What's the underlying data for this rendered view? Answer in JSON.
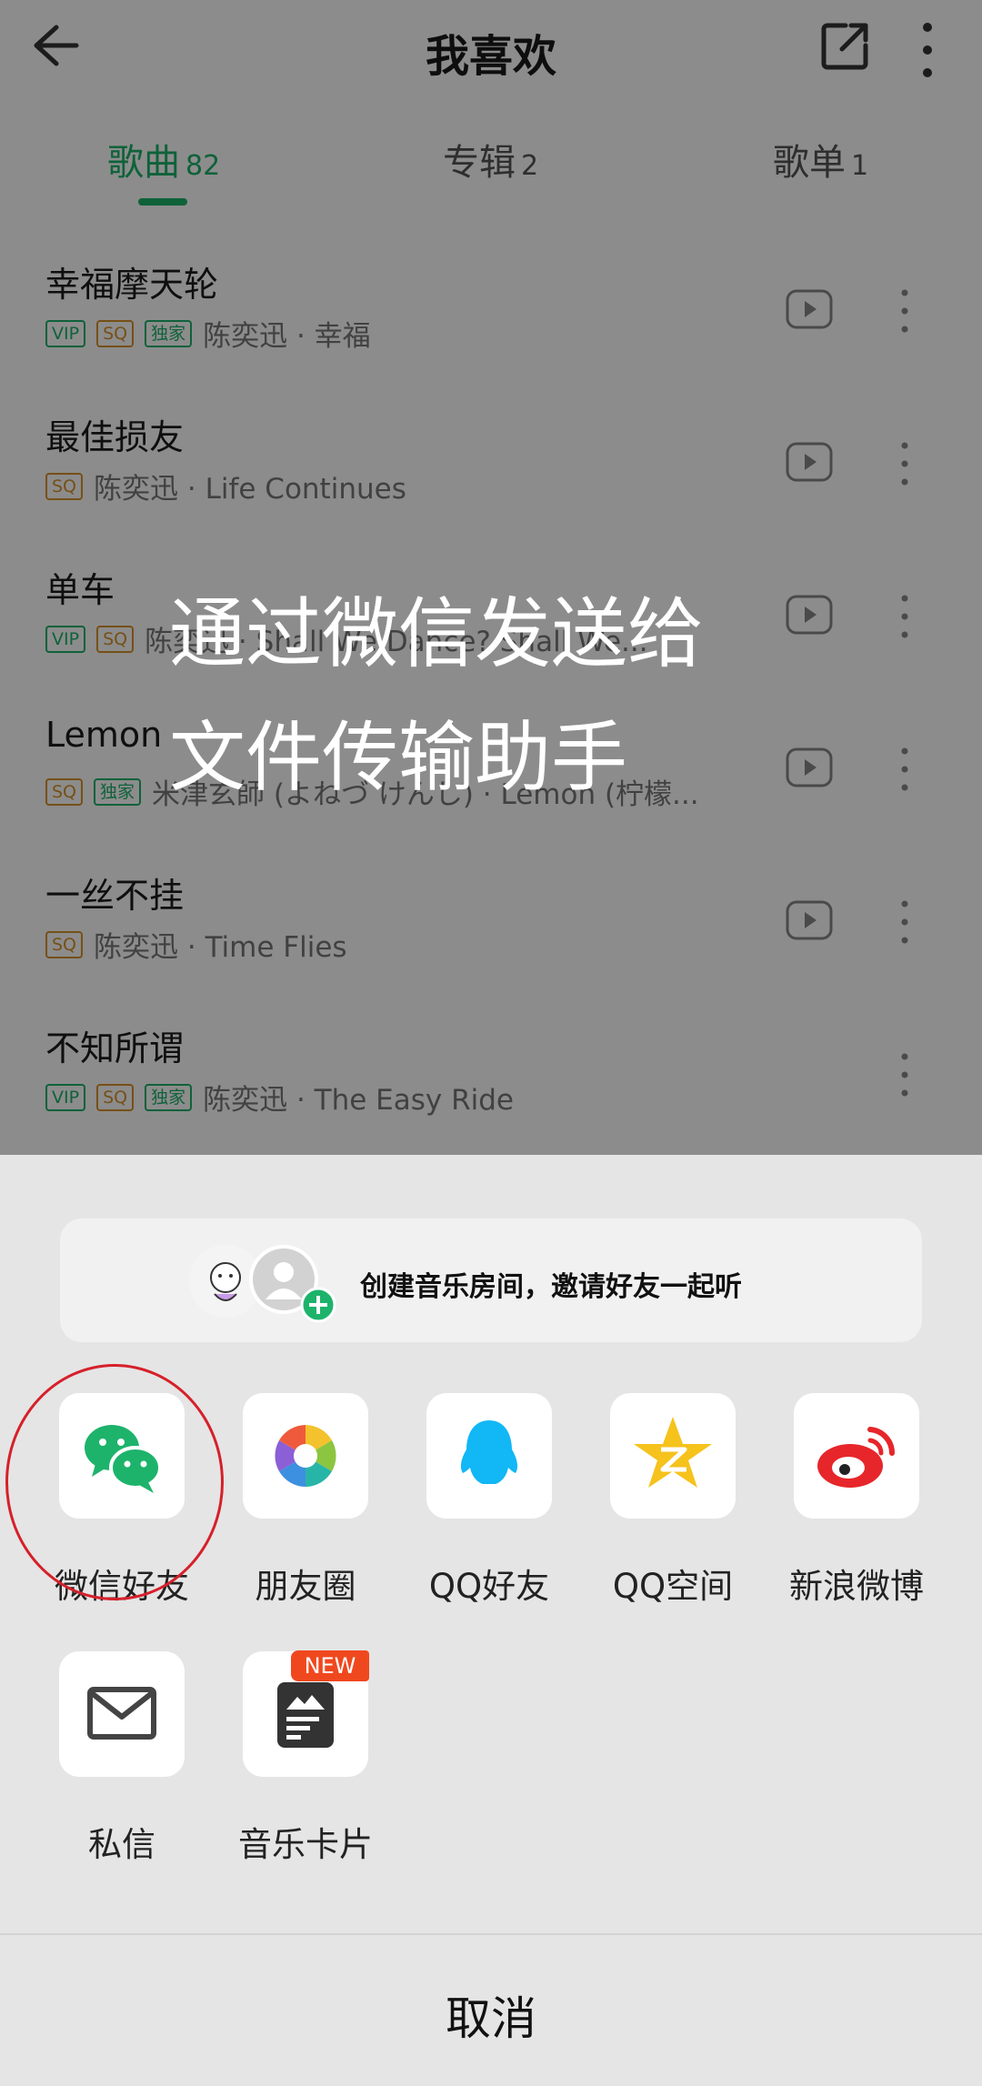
{
  "header": {
    "title": "我喜欢"
  },
  "tabs": [
    {
      "label": "歌曲",
      "count": "82"
    },
    {
      "label": "专辑",
      "count": "2"
    },
    {
      "label": "歌单",
      "count": "1"
    }
  ],
  "songs": [
    {
      "title": "幸福摩天轮",
      "tags": [
        "VIP",
        "SQ",
        "独家"
      ],
      "subtitle": "陈奕迅 · 幸福"
    },
    {
      "title": "最佳损友",
      "tags": [
        "SQ"
      ],
      "subtitle": "陈奕迅 · Life Continues"
    },
    {
      "title": "单车",
      "tags": [
        "VIP",
        "SQ"
      ],
      "subtitle": "陈奕迅 · Shall We Dance? Shall We..."
    },
    {
      "title": "Lemon",
      "tags": [
        "SQ",
        "独家"
      ],
      "subtitle": "米津玄師 (よねづ けんし) · Lemon (柠檬..."
    },
    {
      "title": "一丝不挂",
      "tags": [
        "SQ"
      ],
      "subtitle": "陈奕迅 · Time Flies"
    },
    {
      "title": "不知所谓",
      "tags": [
        "VIP",
        "SQ",
        "独家"
      ],
      "subtitle": "陈奕迅 · The Easy Ride"
    }
  ],
  "overlay": {
    "line1": "通过微信发送给",
    "line2": "文件传输助手"
  },
  "share_sheet": {
    "room_invite": "创建音乐房间，邀请好友一起听",
    "apps": [
      {
        "label": "微信好友",
        "icon": "wechat-icon"
      },
      {
        "label": "朋友圈",
        "icon": "moments-icon"
      },
      {
        "label": "QQ好友",
        "icon": "qq-icon"
      },
      {
        "label": "QQ空间",
        "icon": "qzone-icon"
      },
      {
        "label": "新浪微博",
        "icon": "weibo-icon"
      },
      {
        "label": "私信",
        "icon": "mail-icon"
      },
      {
        "label": "音乐卡片",
        "icon": "music-card-icon",
        "badge": "NEW"
      }
    ],
    "cancel": "取消"
  },
  "colors": {
    "accent": "#1db36b",
    "sq": "#d8932a",
    "badge": "#f0481e",
    "highlight_ring": "#d6202a"
  }
}
